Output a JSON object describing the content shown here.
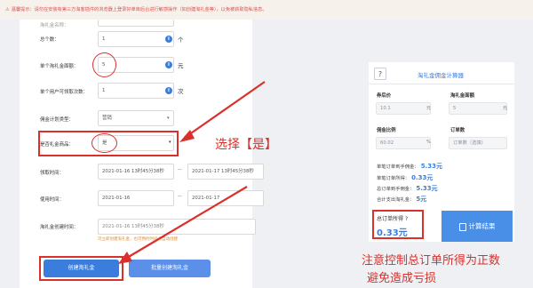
{
  "notice": "温馨提示：请勿在安装有第三方淘客插件的浏览器上登录好单库后台进行敏感操作（如创建淘礼金等），以免被获取隐私信息。",
  "form": {
    "top_partial_label": "淘礼金名称：",
    "total_count": {
      "label": "总个数：",
      "value": "1",
      "unit": "个"
    },
    "unit_amount": {
      "label": "单个淘礼金面额：",
      "value": "5",
      "unit": "元"
    },
    "per_user_limit": {
      "label": "单个用户可领取次数：",
      "value": "1",
      "unit": "次"
    },
    "commission_type": {
      "label": "佣金计划类型：",
      "value": "营销"
    },
    "cash_deal": {
      "label": "是否礼金商品：",
      "value": "是"
    },
    "claim_time": {
      "label": "领取时间：",
      "start": "2021-01-16 13时45分38秒",
      "end": "2021-01-17 13时45分38秒"
    },
    "use_time": {
      "label": "使用时间：",
      "start": "2021-01-16",
      "end": "2021-01-17"
    },
    "create_time": {
      "label": "淘礼金创建时间：",
      "value": "2021-01-16 13时45分38秒",
      "hint": "可立即创建淘礼金，也可预约时间点自动创建"
    },
    "create_button": "创建淘礼金",
    "batch_button": "批量创建淘礼金"
  },
  "annotations": {
    "select_yes": "选择【是】",
    "profit_line1": "注意控制总订单所得为正数",
    "profit_line2": "避免造成亏损"
  },
  "calculator": {
    "icon_text": "?",
    "title": "淘礼金佣金计算器",
    "coupon_price": {
      "label": "券后价",
      "value": "10.1",
      "unit": "元"
    },
    "tlj_amount": {
      "label": "淘礼金面额",
      "value": "5",
      "unit": "元"
    },
    "commission_rate": {
      "label": "佣金比例",
      "value": "60.02",
      "unit": "%"
    },
    "order_count": {
      "label": "订单数",
      "placeholder": "订单数（选填）"
    },
    "results": [
      {
        "label": "单笔订单到手佣金：",
        "value": "5.33元"
      },
      {
        "label": "单笔订单所得：",
        "value": "0.33元"
      },
      {
        "label": "总订单到手佣金：",
        "value": "5.33元"
      },
      {
        "label": "合计支出淘礼金：",
        "value": "5元"
      }
    ],
    "total_label": "总订单所得",
    "total_value": "0.33元",
    "calc_button": "计算结果"
  },
  "colors": {
    "accent": "#3b7ddd",
    "annotation_red": "#d9302c",
    "notice_bg": "#f7f1ec"
  }
}
